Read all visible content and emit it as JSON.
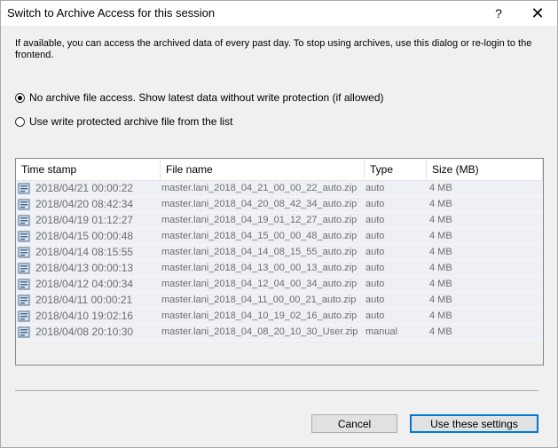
{
  "window": {
    "title": "Switch to Archive Access for this session",
    "help_label": "?",
    "close_label": "✕"
  },
  "description": "If available, you can access the archived data of every past day. To stop using archives, use this dialog or re-login to the frontend.",
  "options": [
    {
      "label": "No archive file access. Show latest data without write protection (if allowed)",
      "checked": true
    },
    {
      "label": "Use write protected archive file from the list",
      "checked": false
    }
  ],
  "table": {
    "columns": [
      "Time stamp",
      "File name",
      "Type",
      "Size (MB)"
    ],
    "rows": [
      {
        "timestamp": "2018/04/21 00:00:22",
        "file": "master.lani_2018_04_21_00_00_22_auto.zip",
        "type": "auto",
        "size": "4 MB"
      },
      {
        "timestamp": "2018/04/20 08:42:34",
        "file": "master.lani_2018_04_20_08_42_34_auto.zip",
        "type": "auto",
        "size": "4 MB"
      },
      {
        "timestamp": "2018/04/19 01:12:27",
        "file": "master.lani_2018_04_19_01_12_27_auto.zip",
        "type": "auto",
        "size": "4 MB"
      },
      {
        "timestamp": "2018/04/15 00:00:48",
        "file": "master.lani_2018_04_15_00_00_48_auto.zip",
        "type": "auto",
        "size": "4 MB"
      },
      {
        "timestamp": "2018/04/14 08:15:55",
        "file": "master.lani_2018_04_14_08_15_55_auto.zip",
        "type": "auto",
        "size": "4 MB"
      },
      {
        "timestamp": "2018/04/13 00:00:13",
        "file": "master.lani_2018_04_13_00_00_13_auto.zip",
        "type": "auto",
        "size": "4 MB"
      },
      {
        "timestamp": "2018/04/12 04:00:34",
        "file": "master.lani_2018_04_12_04_00_34_auto.zip",
        "type": "auto",
        "size": "4 MB"
      },
      {
        "timestamp": "2018/04/11 00:00:21",
        "file": "master.lani_2018_04_11_00_00_21_auto.zip",
        "type": "auto",
        "size": "4 MB"
      },
      {
        "timestamp": "2018/04/10 19:02:16",
        "file": "master.lani_2018_04_10_19_02_16_auto.zip",
        "type": "auto",
        "size": "4 MB"
      },
      {
        "timestamp": "2018/04/08 20:10:30",
        "file": "master.lani_2018_04_08_20_10_30_User.zip",
        "type": "manual",
        "size": "4 MB"
      }
    ]
  },
  "buttons": {
    "cancel": "Cancel",
    "apply": "Use these settings"
  }
}
